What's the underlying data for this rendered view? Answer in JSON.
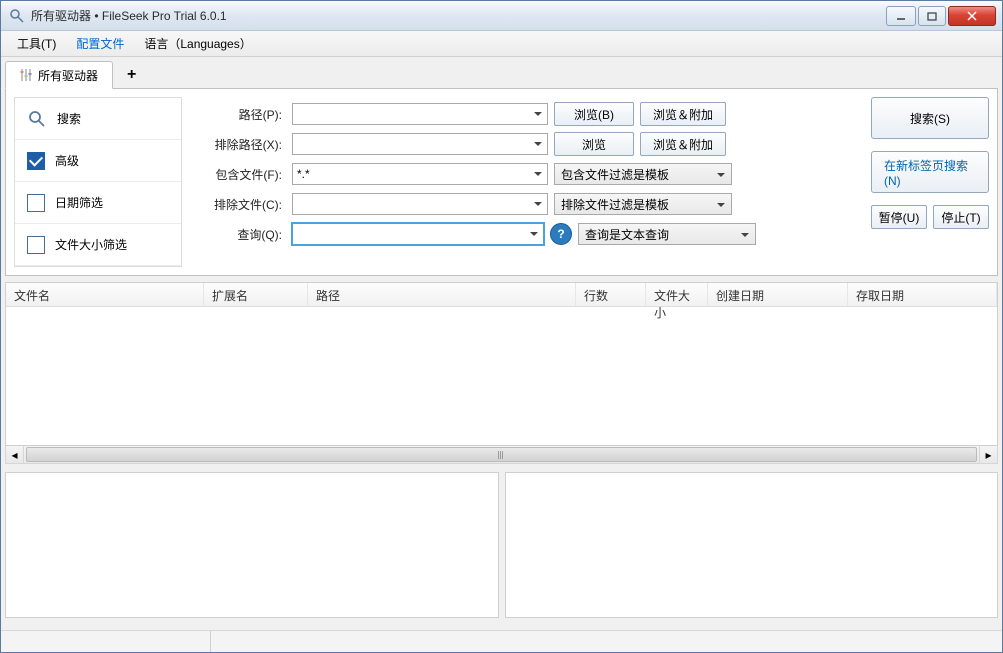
{
  "window": {
    "title": "所有驱动器 • FileSeek Pro Trial 6.0.1"
  },
  "menu": {
    "tools": "工具(T)",
    "profiles": "配置文件",
    "languages": "语言（Languages）"
  },
  "tabs": {
    "active": "所有驱动器",
    "add": "+"
  },
  "sidenav": {
    "search": "搜索",
    "advanced": "高级",
    "date_filter": "日期筛选",
    "size_filter": "文件大小筛选"
  },
  "form": {
    "labels": {
      "path": "路径(P):",
      "exclude_path": "排除路径(X):",
      "include_file": "包含文件(F):",
      "exclude_file": "排除文件(C):",
      "query": "查询(Q):"
    },
    "values": {
      "path": "",
      "exclude_path": "",
      "include_file": "*.*",
      "exclude_file": "",
      "query": ""
    },
    "dd": {
      "include_mode": "包含文件过滤是模板",
      "exclude_mode": "排除文件过滤是模板",
      "query_mode": "查询是文本查询"
    },
    "buttons": {
      "browse": "浏览(B)",
      "browse2": "浏览",
      "browse_append": "浏览＆附加",
      "help": "?"
    }
  },
  "actions": {
    "search": "搜索(S)",
    "search_newtab": "在新标签页搜索(N)",
    "pause": "暂停(U)",
    "stop": "停止(T)"
  },
  "table": {
    "cols": {
      "filename": "文件名",
      "ext": "扩展名",
      "path": "路径",
      "lines": "行数",
      "size": "文件大小",
      "created": "创建日期",
      "accessed": "存取日期"
    },
    "rows": []
  }
}
